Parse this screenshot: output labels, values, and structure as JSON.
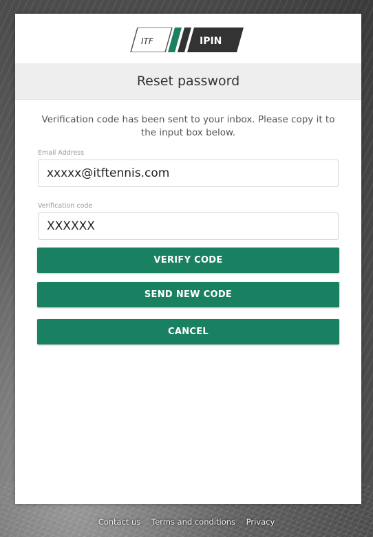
{
  "brand": {
    "logo_left": "ITF",
    "logo_right": "IPIN"
  },
  "title": "Reset password",
  "message": "Verification code has been sent to your inbox. Please copy it to the input box below.",
  "email": {
    "label": "Email Address",
    "value": "xxxxx@itftennis.com"
  },
  "code": {
    "label": "Verification code",
    "value": "XXXXXX"
  },
  "buttons": {
    "verify": "VERIFY CODE",
    "send_new": "SEND NEW CODE",
    "cancel": "CANCEL"
  },
  "footer": {
    "contact": "Contact us",
    "terms": "Terms and conditions",
    "privacy": "Privacy"
  },
  "colors": {
    "accent": "#1a8062",
    "logo_dark": "#333333"
  }
}
